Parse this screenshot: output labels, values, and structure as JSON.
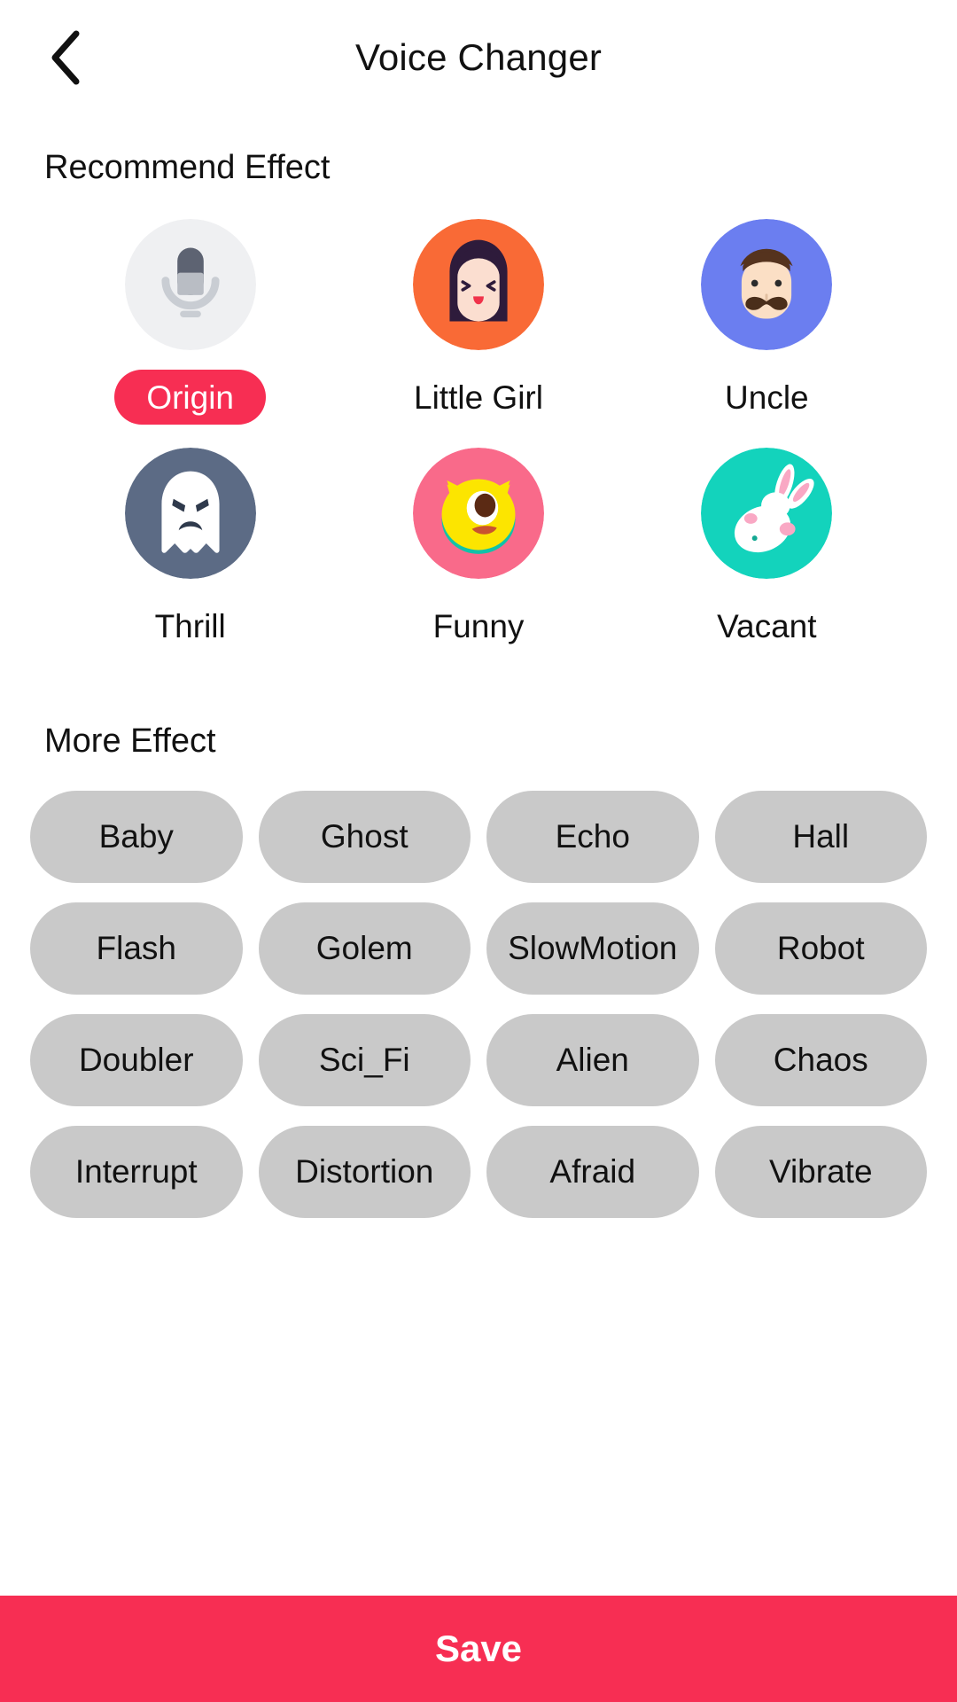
{
  "header": {
    "back_icon": "chevron-left-icon",
    "title": "Voice Changer"
  },
  "recommend": {
    "section_title": "Recommend Effect",
    "items": [
      {
        "label": "Origin",
        "icon": "microphone-icon",
        "bg": "#EFF0F2",
        "selected": true
      },
      {
        "label": "Little Girl",
        "icon": "girl-face-icon",
        "bg": "#F96A36",
        "selected": false
      },
      {
        "label": "Uncle",
        "icon": "man-face-icon",
        "bg": "#6B7EF0",
        "selected": false
      },
      {
        "label": "Thrill",
        "icon": "ghost-icon",
        "bg": "#5C6B85",
        "selected": false
      },
      {
        "label": "Funny",
        "icon": "monster-icon",
        "bg": "#F96A8A",
        "selected": false
      },
      {
        "label": "Vacant",
        "icon": "rabbit-icon",
        "bg": "#13D3BC",
        "selected": false
      }
    ]
  },
  "more": {
    "section_title": "More Effect",
    "chips": [
      "Baby",
      "Ghost",
      "Echo",
      "Hall",
      "Flash",
      "Golem",
      "SlowMotion",
      "Robot",
      "Doubler",
      "Sci_Fi",
      "Alien",
      "Chaos",
      "Interrupt",
      "Distortion",
      "Afraid",
      "Vibrate"
    ]
  },
  "footer": {
    "save_label": "Save"
  },
  "colors": {
    "accent": "#F72E53",
    "chip_bg": "#C9C9C9",
    "text": "#111111"
  }
}
